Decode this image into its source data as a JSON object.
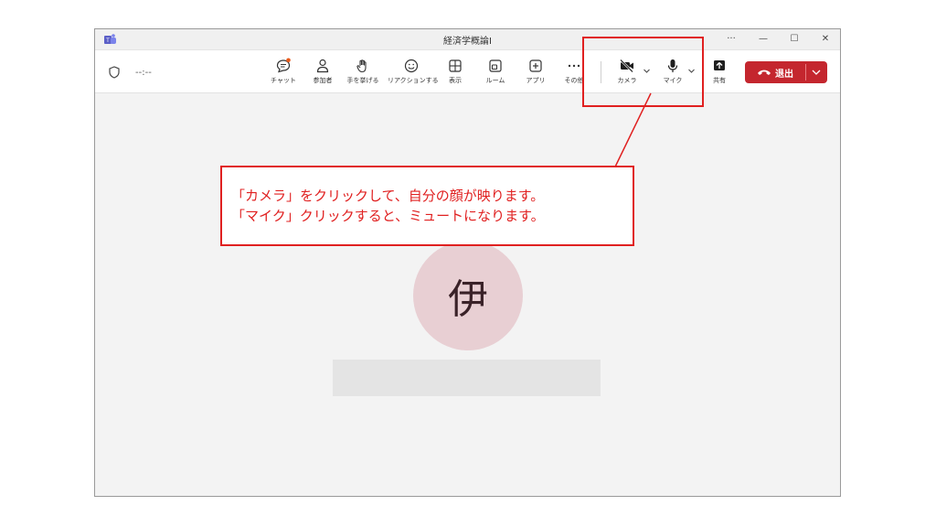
{
  "window": {
    "title": "経済学概論Ⅰ",
    "more_label": "···",
    "minimize_label": "—",
    "maximize_label": "☐",
    "close_label": "✕"
  },
  "toolbar": {
    "timer": "--:--",
    "buttons": {
      "chat": "チャット",
      "participants": "参加者",
      "raise_hand": "手を挙げる",
      "reactions": "リアクションする",
      "view": "表示",
      "rooms": "ルーム",
      "apps": "アプリ",
      "more": "その他",
      "camera": "カメラ",
      "mic": "マイク",
      "share": "共有"
    },
    "leave_label": "退出"
  },
  "stage": {
    "avatar_initial": "伊"
  },
  "annotation": {
    "line1": "「カメラ」をクリックして、自分の顔が映ります。",
    "line2": "「マイク」クリックすると、ミュートになります。"
  },
  "colors": {
    "accent_red": "#e02020",
    "leave_red": "#c4262e",
    "avatar_bg": "#e8cfd3",
    "chat_badge": "#e8591a"
  }
}
